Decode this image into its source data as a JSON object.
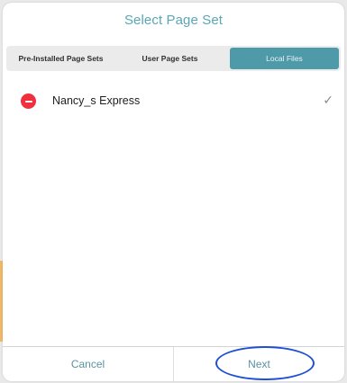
{
  "dialog": {
    "title": "Select Page Set"
  },
  "segments": [
    {
      "label": "Pre-Installed Page Sets",
      "active": false
    },
    {
      "label": "User Page Sets",
      "active": false
    },
    {
      "label": "Local Files",
      "active": true
    }
  ],
  "list": {
    "items": [
      {
        "label": "Nancy_s Express",
        "selected": true,
        "icon": "delete-icon",
        "check": "✓"
      }
    ]
  },
  "footer": {
    "cancel_label": "Cancel",
    "next_label": "Next"
  },
  "colors": {
    "title": "#5aa7b6",
    "accent_segment": "#4e9aa9",
    "delete": "#f0303e",
    "annotation_ring": "#1f4fd6"
  }
}
